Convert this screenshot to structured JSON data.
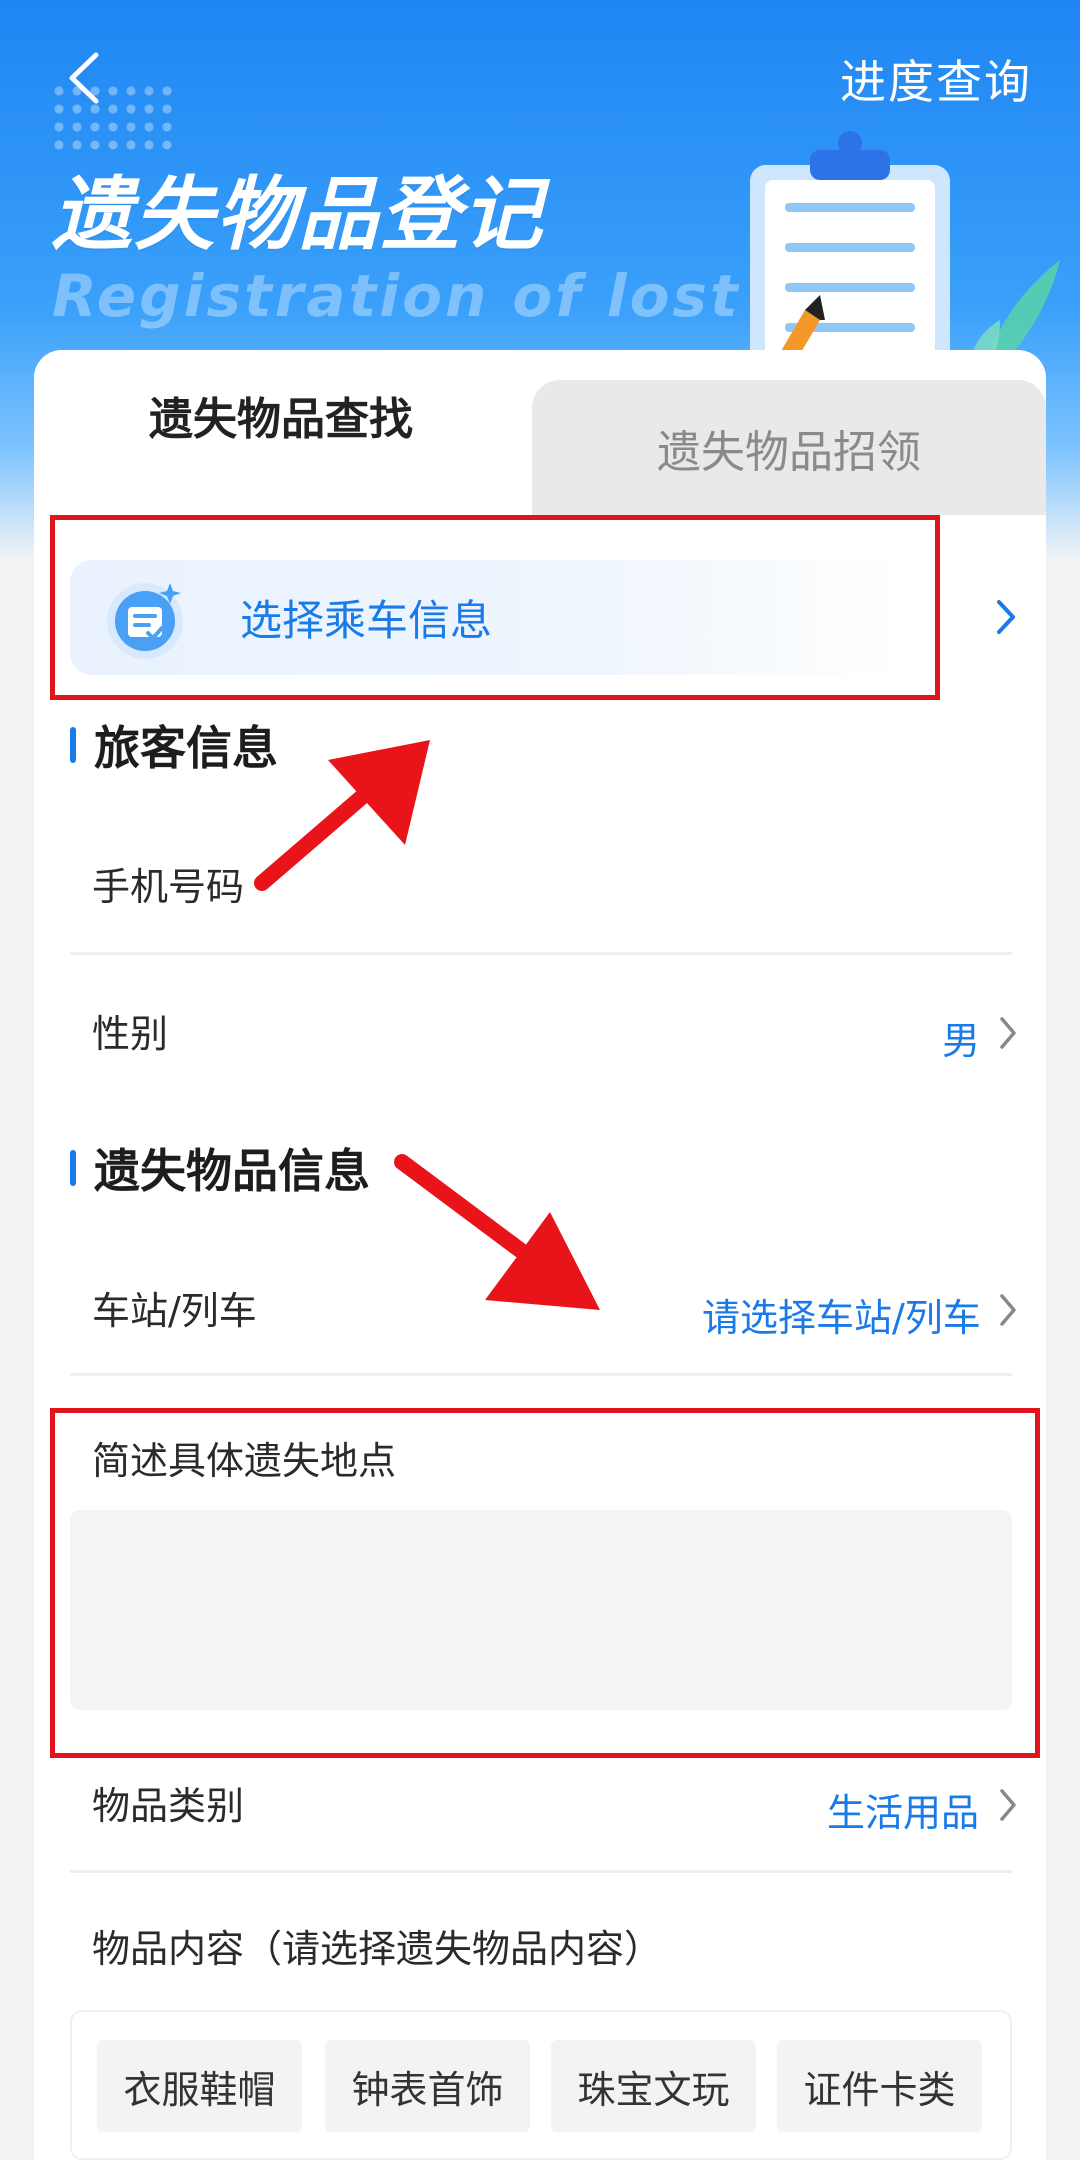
{
  "header": {
    "progress_label": "进度查询",
    "title": "遗失物品登记",
    "subtitle": "Registration of lost"
  },
  "tabs": [
    {
      "label": "遗失物品查找",
      "active": true
    },
    {
      "label": "遗失物品招领",
      "active": false
    }
  ],
  "ride_select": {
    "label": "选择乘车信息"
  },
  "passenger_section": {
    "title": "旅客信息",
    "phone_label": "手机号码",
    "gender_label": "性别",
    "gender_value": "男"
  },
  "lost_section": {
    "title": "遗失物品信息",
    "station_label": "车站/列车",
    "station_placeholder": "请选择车站/列车",
    "location_label": "简述具体遗失地点",
    "category_label": "物品类别",
    "category_value": "生活用品",
    "content_label": "物品内容（请选择遗失物品内容）",
    "chips": [
      "衣服鞋帽",
      "钟表首饰",
      "珠宝文玩",
      "证件卡类"
    ]
  },
  "colors": {
    "accent": "#1a7be8",
    "header_blue": "#1f86f3",
    "highlight_red": "#e0141a"
  },
  "icons": [
    "back-icon",
    "clipboard-illustration",
    "leaf-illustration",
    "ticket-icon",
    "chevron-right-icon"
  ]
}
